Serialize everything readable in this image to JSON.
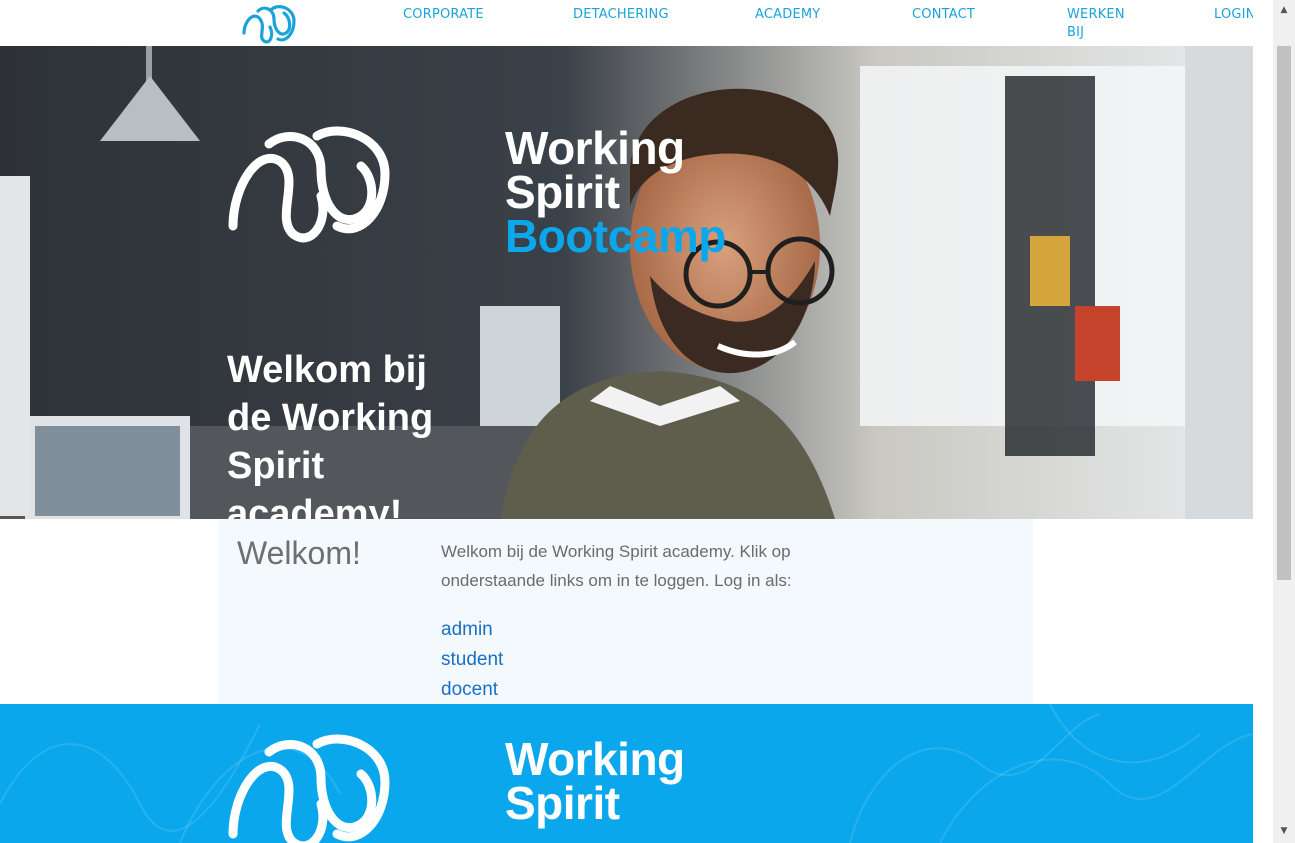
{
  "nav": {
    "items": [
      "CORPORATE",
      "DETACHERING",
      "ACADEMY",
      "CONTACT",
      "WERKEN",
      "LOGIN"
    ],
    "werken_line2": "BIJ"
  },
  "hero": {
    "brand_line1": "Working",
    "brand_line2": "Spirit",
    "brand_line3": "Bootcamp",
    "welcome": "Welkom bij de Working Spirit academy!"
  },
  "intro": {
    "title": "Welkom!",
    "text": "Welkom bij de Working Spirit academy. Klik op onderstaande links om in te loggen. Log in als:",
    "links": [
      "admin",
      "student",
      "docent"
    ]
  },
  "footer": {
    "brand_line1": "Working",
    "brand_line2": "Spirit"
  },
  "colors": {
    "accent": "#0aa7ec",
    "nav": "#1aa3db",
    "link": "#1a6fc6"
  }
}
